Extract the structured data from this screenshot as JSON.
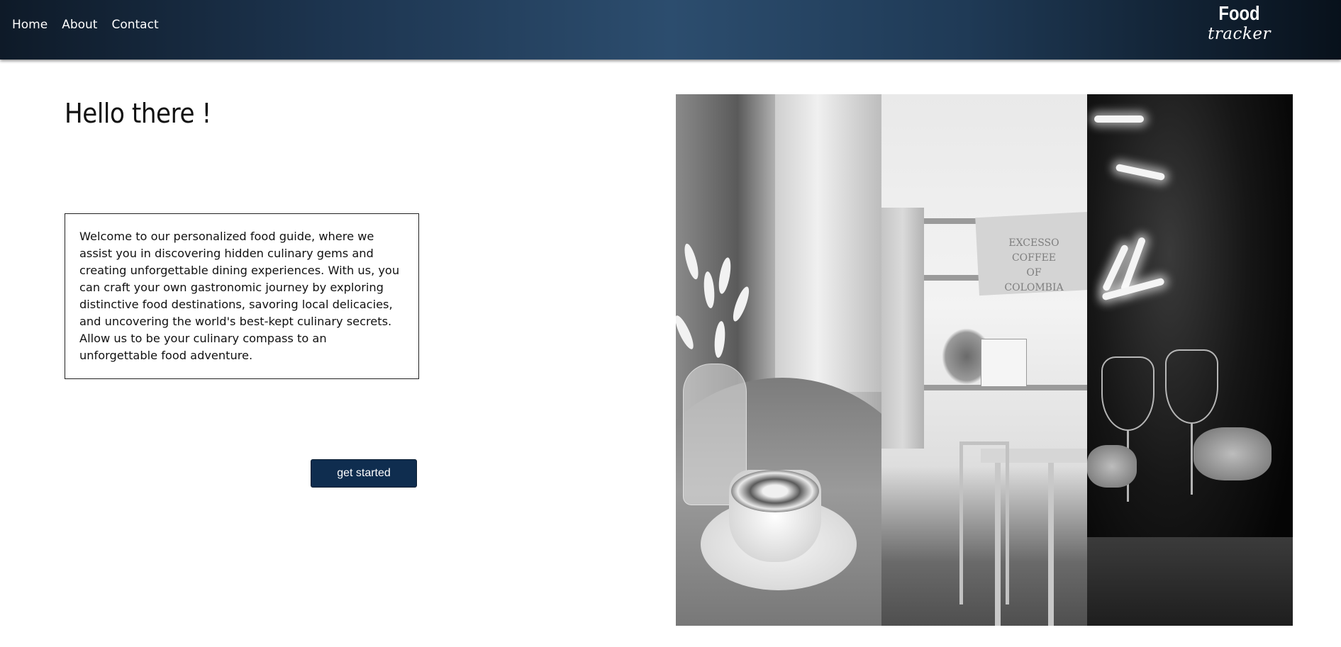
{
  "nav": {
    "links": [
      "Home",
      "About",
      "Contact"
    ]
  },
  "logo": {
    "top": "Food",
    "bottom": "tracker"
  },
  "main": {
    "heading": "Hello there !",
    "intro": "Welcome to our personalized food guide, where we assist you in discovering hidden culinary gems and creating unforgettable dining experiences. With us, you can craft your own gastronomic journey by exploring distinctive food destinations, savoring local delicacies, and uncovering the world's best-kept culinary secrets. Allow us to be your culinary compass to an unforgettable food adventure.",
    "cta_label": "get started"
  },
  "gallery": {
    "photo2_sign": [
      "EXCESSO",
      "COFFEE",
      "OF",
      "COLOMBIA"
    ]
  },
  "colors": {
    "button": "#0f2d4f",
    "nav_gradient_start": "#0e1a28",
    "nav_gradient_mid": "#2c4d6e"
  }
}
